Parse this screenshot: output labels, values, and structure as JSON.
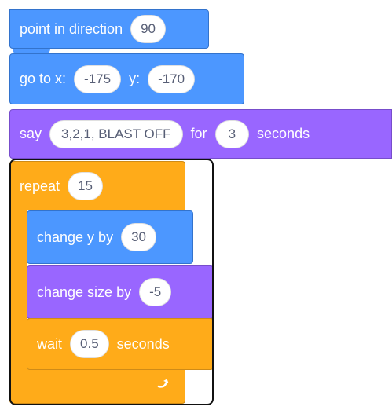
{
  "colors": {
    "motion": "#4c97ff",
    "looks": "#9966ff",
    "control": "#ffab19",
    "input_text": "#575e75"
  },
  "blocks": {
    "point_in_direction": {
      "label": "point in direction",
      "value": "90"
    },
    "go_to": {
      "label_x": "go to x:",
      "x_value": "-175",
      "label_y": "y:",
      "y_value": "-170"
    },
    "say_for": {
      "label": "say",
      "message": "3,2,1, BLAST OFF",
      "label_for": "for",
      "seconds_value": "3",
      "label_seconds": "seconds"
    },
    "repeat": {
      "label": "repeat",
      "count": "15",
      "loop_icon": "repeat-arrow-icon"
    },
    "change_y": {
      "label": "change y by",
      "value": "30"
    },
    "change_size": {
      "label": "change size by",
      "value": "-5"
    },
    "wait": {
      "label": "wait",
      "value": "0.5",
      "label_seconds": "seconds"
    }
  }
}
